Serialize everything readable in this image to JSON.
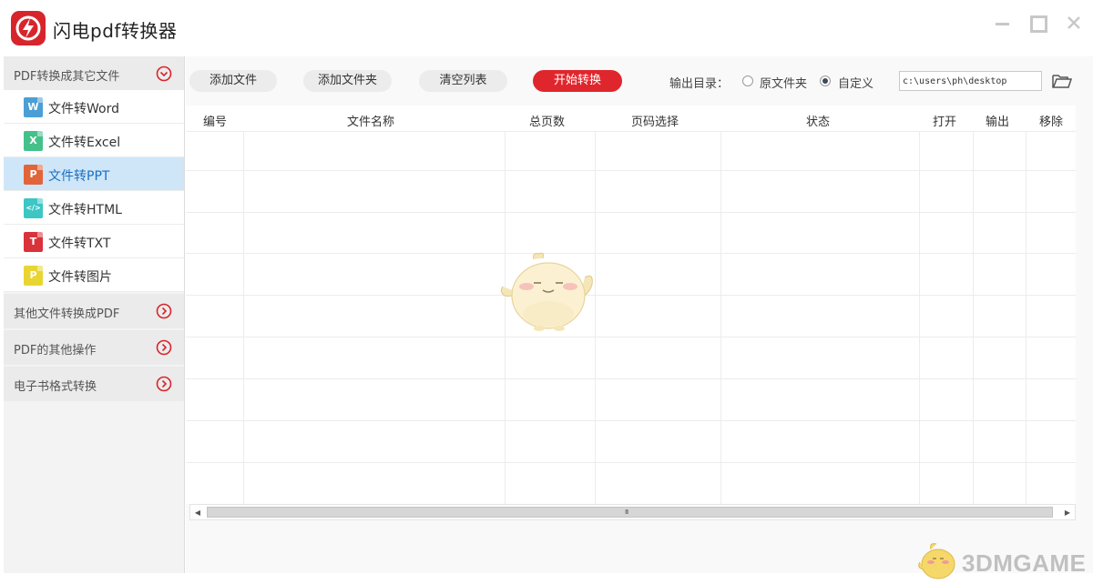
{
  "app": {
    "title": "闪电pdf转换器",
    "logo_color": "#d7252b"
  },
  "window_controls": [
    "minimize",
    "maximize",
    "close"
  ],
  "sidebar": {
    "categories": [
      {
        "label": "PDF转换成其它文件",
        "expanded": true,
        "icon": "chevron-down-circle-icon",
        "items": [
          {
            "label": "文件转Word",
            "icon": "word-file-icon",
            "icon_char": "W",
            "color": "#4b9fd5",
            "active": false
          },
          {
            "label": "文件转Excel",
            "icon": "excel-file-icon",
            "icon_char": "X",
            "color": "#46c08b",
            "active": false
          },
          {
            "label": "文件转PPT",
            "icon": "ppt-file-icon",
            "icon_char": "P",
            "color": "#e2643a",
            "active": true
          },
          {
            "label": "文件转HTML",
            "icon": "html-file-icon",
            "icon_char": "</>",
            "color": "#3cc6c4",
            "active": false
          },
          {
            "label": "文件转TXT",
            "icon": "txt-file-icon",
            "icon_char": "T",
            "color": "#d9323a",
            "active": false
          },
          {
            "label": "文件转图片",
            "icon": "image-file-icon",
            "icon_char": "P",
            "color": "#e9d531",
            "active": false
          }
        ]
      },
      {
        "label": "其他文件转换成PDF",
        "expanded": false,
        "icon": "chevron-right-circle-icon"
      },
      {
        "label": "PDF的其他操作",
        "expanded": false,
        "icon": "chevron-right-circle-icon"
      },
      {
        "label": "电子书格式转换",
        "expanded": false,
        "icon": "chevron-right-circle-icon"
      }
    ]
  },
  "toolbar": {
    "add_file": "添加文件",
    "add_folder": "添加文件夹",
    "clear_list": "清空列表",
    "start": "开始转换",
    "output_dir_label": "输出目录：",
    "option_original": "原文件夹",
    "option_custom": "自定义",
    "selected_option": "custom",
    "output_path": "c:\\users\\ph\\desktop"
  },
  "table": {
    "columns": [
      "编号",
      "文件名称",
      "总页数",
      "页码选择",
      "状态",
      "打开",
      "输出",
      "移除"
    ],
    "rows": []
  },
  "scrollbar": {
    "grip": "III"
  },
  "watermark": {
    "text": "3DMGAME"
  }
}
